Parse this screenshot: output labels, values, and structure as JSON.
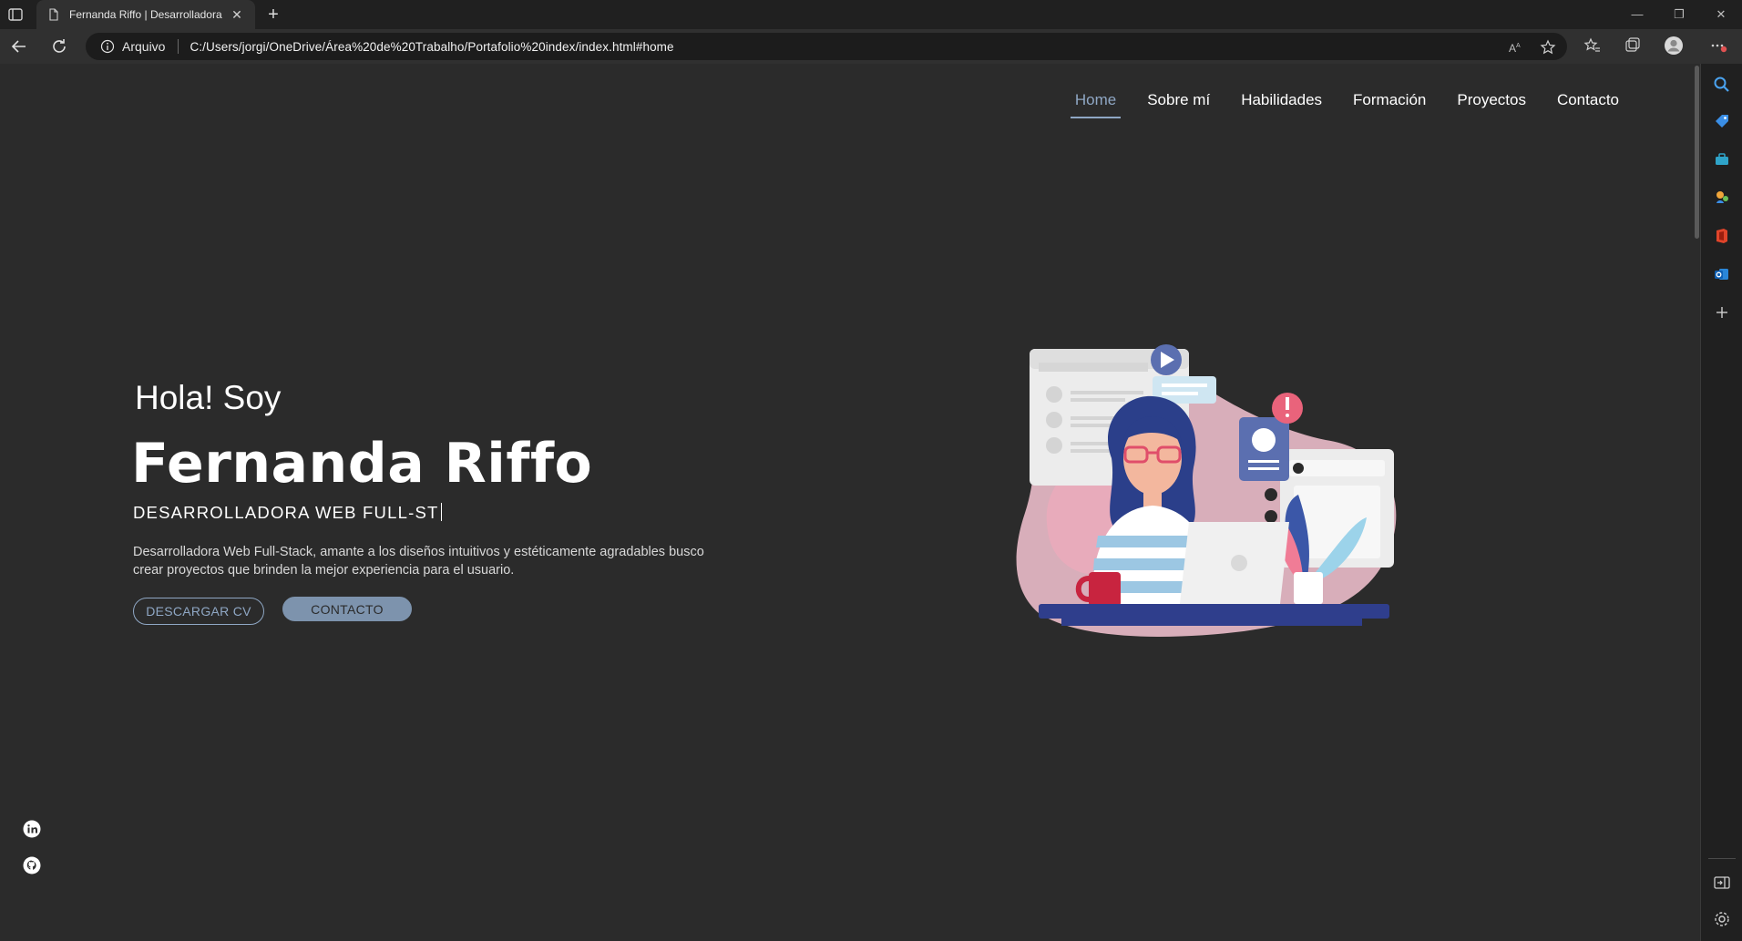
{
  "browser": {
    "tab_title": "Fernanda Riffo | Desarrolladora Web",
    "address_label": "Arquivo",
    "url": "C:/Users/jorgi/OneDrive/Área%20de%20Trabalho/Portafolio%20index/index.html#home"
  },
  "nav": {
    "items": [
      {
        "label": "Home",
        "active": true
      },
      {
        "label": "Sobre mí"
      },
      {
        "label": "Habilidades"
      },
      {
        "label": "Formación"
      },
      {
        "label": "Proyectos"
      },
      {
        "label": "Contacto"
      }
    ]
  },
  "hero": {
    "greeting": "Hola! Soy",
    "name": "Fernanda Riffo",
    "role": "DESARROLLADORA WEB FULL-ST",
    "description_line1": "Desarrolladora Web Full-Stack, amante a los diseños intuitivos y estéticamente agradables busco",
    "description_line2": "crear proyectos que brinden la mejor experiencia para el usuario.",
    "btn_cv": "DESCARGAR CV",
    "btn_contact": "CONTACTO"
  },
  "social": [
    "linkedin-icon",
    "github-icon"
  ],
  "colors": {
    "page_bg": "#2b2b2b",
    "accent": "#8fa7c4",
    "chrome_bg": "#202020"
  }
}
